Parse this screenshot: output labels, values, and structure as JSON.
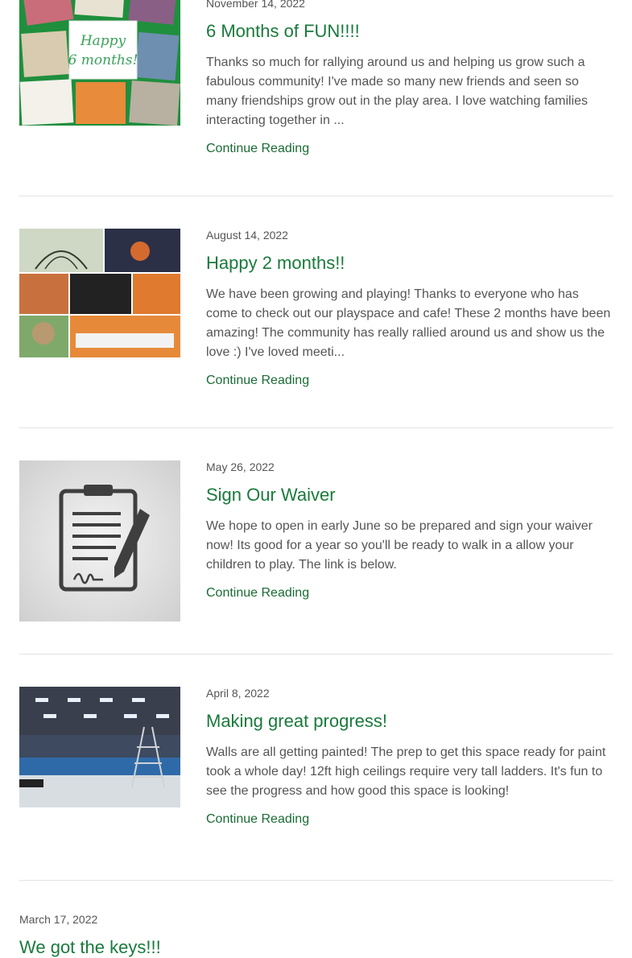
{
  "posts": [
    {
      "date": "November 14, 2022",
      "title": "6 Months of FUN!!!!",
      "excerpt": "Thanks so much for rallying around us and helping us grow such a fabulous community! I've made so many new friends and seen so many friendships grow out in the play area. I love watching families interacting together in ...",
      "link": "Continue Reading",
      "image_text": "Happy 6 months!"
    },
    {
      "date": "August 14, 2022",
      "title": "Happy 2 months!!",
      "excerpt": "We have been growing and playing! Thanks to everyone who has come to check out our playspace and cafe! These 2 months have been amazing! The community has really rallied around us and show us the love :) I've loved meeti...",
      "link": "Continue Reading"
    },
    {
      "date": "May 26, 2022",
      "title": "Sign Our Waiver",
      "excerpt": "We hope to open in early June so be prepared and sign your waiver now! Its good for a year so you'll be ready to walk in a allow your children to play. The link is below.",
      "link": "Continue Reading"
    },
    {
      "date": "April 8, 2022",
      "title": "Making great progress!",
      "excerpt": "Walls are all getting painted! The prep to get this space ready for paint took a whole day! 12ft high ceilings require very tall ladders. It's fun to see the progress and how good this space is looking!",
      "link": "Continue Reading"
    },
    {
      "date": "March 17, 2022",
      "title": "We got the keys!!!"
    }
  ],
  "colors": {
    "accent": "#1a7a3c",
    "text": "#555555",
    "divider": "#e3e3e3"
  }
}
